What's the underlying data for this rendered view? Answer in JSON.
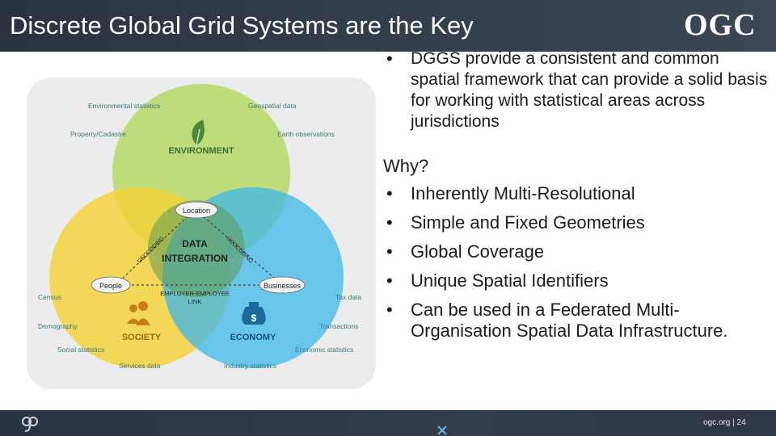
{
  "header": {
    "title": "Discrete Global Grid Systems are the Key",
    "brand": "OGC"
  },
  "intro_bullet": "DGGS provide a consistent and common spatial framework that can provide a solid basis for working with statistical areas across jurisdictions",
  "why": {
    "label": "Why?",
    "items": [
      "Inherently Multi-Resolutional",
      "Simple and Fixed Geometries",
      "Global Coverage",
      "Unique Spatial Identifiers",
      "Can be used in a Federated Multi-Organisation Spatial Data Infrastructure."
    ]
  },
  "diagram": {
    "circles": {
      "environment": "ENVIRONMENT",
      "society": "SOCIETY",
      "economy": "ECONOMY"
    },
    "center": [
      "DATA",
      "INTEGRATION"
    ],
    "nodes": {
      "location": "Location",
      "people": "People",
      "businesses": "Businesses",
      "link": [
        "EMPLOYER-EMPLOYEE",
        "LINK"
      ],
      "geocoding_left": "GEOCODING",
      "geocoding_right": "GEOCODING"
    },
    "labels": {
      "environmental_statistics": "Environmental statistics",
      "geospatial_data": "Geospatial data",
      "property_cadastre": "Property/Cadastre",
      "earth_observations": "Earth observations",
      "census": "Census",
      "tax_data": "Tax data",
      "demography": "Demography",
      "transactions": "Transactions",
      "social_statistics": "Social statistics",
      "economic_statistics": "Economic statistics",
      "services_data": "Services data",
      "industry_statistics": "Industry statistics"
    },
    "colors": {
      "environment": "#b7d96a",
      "society": "#f4d238",
      "economy": "#3fb8ea",
      "overlap": "#6fa85c",
      "label_text": "#3d7a7a",
      "node_text": "#222222"
    },
    "icons": [
      "leaf-icon",
      "people-icon",
      "money-bag-icon"
    ]
  },
  "footer": {
    "page_text": "ogc.org | 24"
  }
}
